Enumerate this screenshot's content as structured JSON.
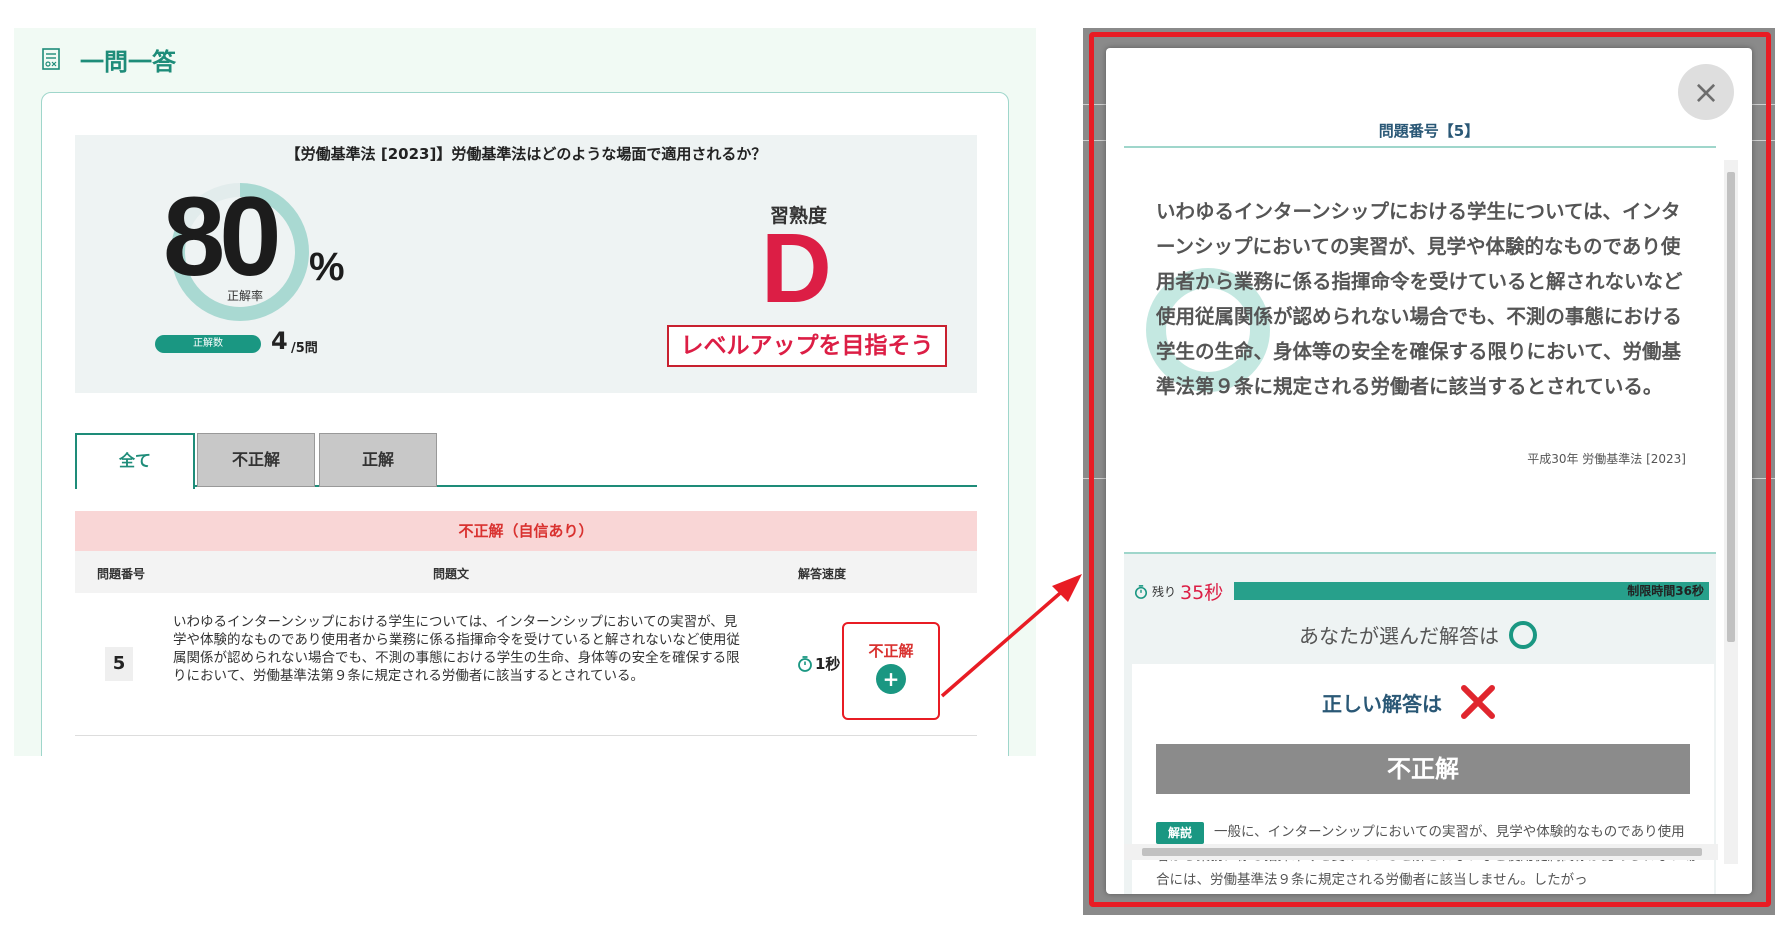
{
  "left": {
    "section_title": "一問一答",
    "question_title": "【労働基準法 [2023]】労働基準法はどのような場面で適用されるか？",
    "rate": {
      "value": "80",
      "unit": "%",
      "label": "正解率",
      "fraction": 0.8
    },
    "correct": {
      "pill_label": "正解数",
      "count": "4",
      "total": "/5問"
    },
    "mastery": {
      "label": "習熟度",
      "grade": "D",
      "message": "レベルアップを目指そう"
    },
    "tabs": [
      {
        "label": "全て",
        "active": true
      },
      {
        "label": "不正解",
        "active": false
      },
      {
        "label": "正解",
        "active": false
      }
    ],
    "group_banner": "不正解（自信あり）",
    "table_header": {
      "num": "問題番号",
      "text": "問題文",
      "speed": "解答速度"
    },
    "row": {
      "num": "5",
      "text": "いわゆるインターンシップにおける学生については、インターンシップにおいての実習が、見学や体験的なものであり使用者から業務に係る指揮命令を受けていると解されないなど使用従属関係が認められない場合でも、不測の事態における学生の生命、身体等の安全を確保する限りにおいて、労働基準法第９条に規定される労働者に該当するとされている。",
      "speed": "1秒",
      "result": "不正解",
      "expand": "+"
    }
  },
  "modal": {
    "close": "×",
    "question_num": "問題番号【5】",
    "question_text": "いわゆるインターンシップにおける学生については、インターンシップにおいての実習が、見学や体験的なものであり使用者から業務に係る指揮命令を受けていると解されないなど使用従属関係が認められない場合でも、不測の事態における学生の生命、身体等の安全を確保する限りにおいて、労働基準法第９条に規定される労働者に該当するとされている。",
    "source": "平成30年 労働基準法 [2023]",
    "timer": {
      "remaining_prefix": "残り",
      "remaining": "35秒",
      "limit": "制限時間36秒",
      "fraction": 0.97
    },
    "your_answer_label": "あなたが選んだ解答は",
    "correct_answer_label": "正しい解答は",
    "verdict": "不正解",
    "explain_badge": "解説",
    "explain_text": "一般に、インターンシップにおいての実習が、見学や体験的なものであり使用者から業務に係る指揮命令を受けていると解されないなど使用従属関係が認められない場合には、労働基準法９条に規定される労働者に該当しません。したがっ"
  },
  "colors": {
    "accent": "#1a9782",
    "danger": "#dc1e45",
    "highlight": "#e81c24"
  },
  "icons": [
    "quiz-icon",
    "stopwatch-icon",
    "plus-icon",
    "close-icon",
    "circle-mark-icon",
    "cross-mark-icon",
    "arrow-icon"
  ]
}
